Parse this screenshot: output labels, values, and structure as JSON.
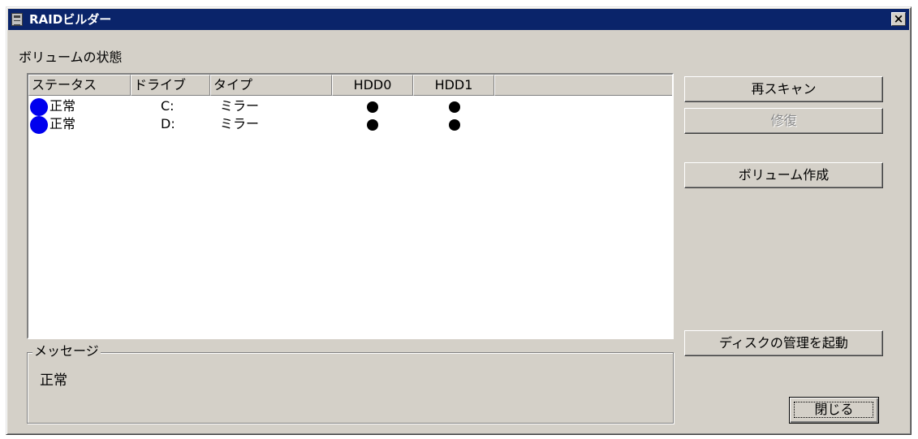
{
  "window": {
    "title": "RAIDビルダー",
    "close_glyph": "×",
    "title_icon": "app-icon"
  },
  "volume_status": {
    "label": "ボリュームの状態",
    "columns": [
      "ステータス",
      "ドライブ",
      "タイプ",
      "HDD0",
      "HDD1"
    ],
    "rows": [
      {
        "status": "正常",
        "status_color": "#0000ee",
        "drive": "C:",
        "type": "ミラー",
        "hdd0": "present",
        "hdd1": "present"
      },
      {
        "status": "正常",
        "status_color": "#0000ee",
        "drive": "D:",
        "type": "ミラー",
        "hdd0": "present",
        "hdd1": "present"
      }
    ]
  },
  "message": {
    "label": "メッセージ",
    "text": "正常"
  },
  "buttons": {
    "rescan": "再スキャン",
    "repair": "修復",
    "create_volume": "ボリューム作成",
    "launch_disk_mgmt": "ディスクの管理を起動",
    "close": "閉じる"
  },
  "colors": {
    "titlebar": "#0a246a",
    "window_bg": "#d4d0c8",
    "status_normal": "#0000ee"
  }
}
